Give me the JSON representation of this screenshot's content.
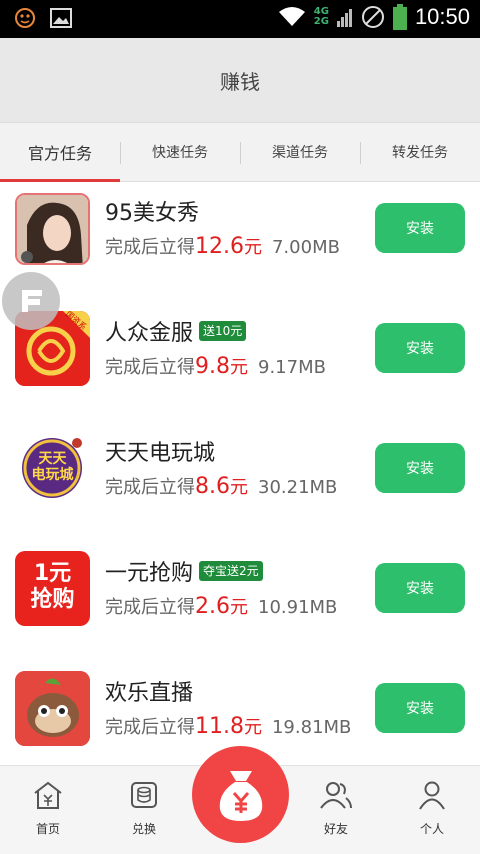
{
  "status_bar": {
    "time": "10:50",
    "network_top": "4G",
    "network_bottom": "2G"
  },
  "header": {
    "title": "赚钱"
  },
  "tabs": [
    {
      "label": "官方任务",
      "active": true
    },
    {
      "label": "快速任务",
      "active": false
    },
    {
      "label": "渠道任务",
      "active": false
    },
    {
      "label": "转发任务",
      "active": false
    }
  ],
  "apps": [
    {
      "name": "95美女秀",
      "badge": "",
      "prefix": "完成后立得",
      "reward": "12.6",
      "unit": "元",
      "size": "7.00MB",
      "install": "安装"
    },
    {
      "name": "人众金服",
      "badge": "送10元",
      "prefix": "完成后立得",
      "reward": "9.8",
      "unit": "元",
      "size": "9.17MB",
      "install": "安装"
    },
    {
      "name": "天天电玩城",
      "badge": "",
      "prefix": "完成后立得",
      "reward": "8.6",
      "unit": "元",
      "size": "30.21MB",
      "install": "安装"
    },
    {
      "name": "一元抢购",
      "badge": "夺宝送2元",
      "prefix": "完成后立得",
      "reward": "2.6",
      "unit": "元",
      "size": "10.91MB",
      "install": "安装"
    },
    {
      "name": "欢乐直播",
      "badge": "",
      "prefix": "完成后立得",
      "reward": "11.8",
      "unit": "元",
      "size": "19.81MB",
      "install": "安装"
    }
  ],
  "icon_text": {
    "app2_corner": "国资系",
    "app3_line1": "天天",
    "app3_line2": "电玩城",
    "app4_line1": "1元",
    "app4_line2": "抢购"
  },
  "bottom_nav": {
    "home": "首页",
    "exchange": "兑换",
    "friends": "好友",
    "profile": "个人"
  },
  "colors": {
    "accent_red": "#e02020",
    "install_green": "#2dbf6c",
    "badge_green": "#1e8c3a",
    "center_button": "#f14445"
  }
}
